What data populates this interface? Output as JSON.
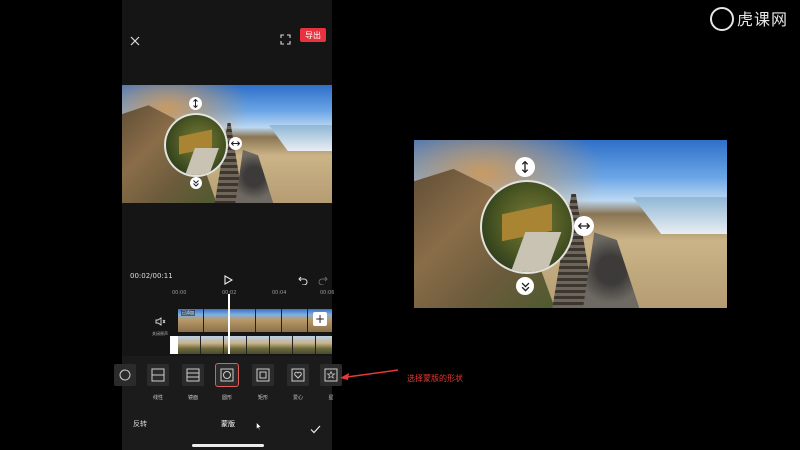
{
  "watermark": "虎课网",
  "header": {
    "export_label": "导出"
  },
  "player": {
    "time": "00:02/00:11"
  },
  "ruler": [
    "00:00",
    "00:02",
    "00:04",
    "00:06"
  ],
  "track": {
    "mute_label": "关闭原声",
    "clip_tag": "已添加",
    "add_symbol": "+"
  },
  "shapes": [
    {
      "label": "",
      "icon": "circle-partial-icon"
    },
    {
      "label": "线性",
      "icon": "linear-mask-icon"
    },
    {
      "label": "镜面",
      "icon": "mirror-mask-icon"
    },
    {
      "label": "圆形",
      "icon": "circle-mask-icon",
      "selected": true
    },
    {
      "label": "矩形",
      "icon": "rectangle-mask-icon"
    },
    {
      "label": "爱心",
      "icon": "heart-mask-icon"
    },
    {
      "label": "星",
      "icon": "star-mask-icon"
    }
  ],
  "footer": {
    "invert_label": "反转",
    "title": "蒙版"
  },
  "annotation": "选择蒙版的形状",
  "colors": {
    "accent_red": "#e8323d",
    "annotation_red": "#e53935"
  }
}
